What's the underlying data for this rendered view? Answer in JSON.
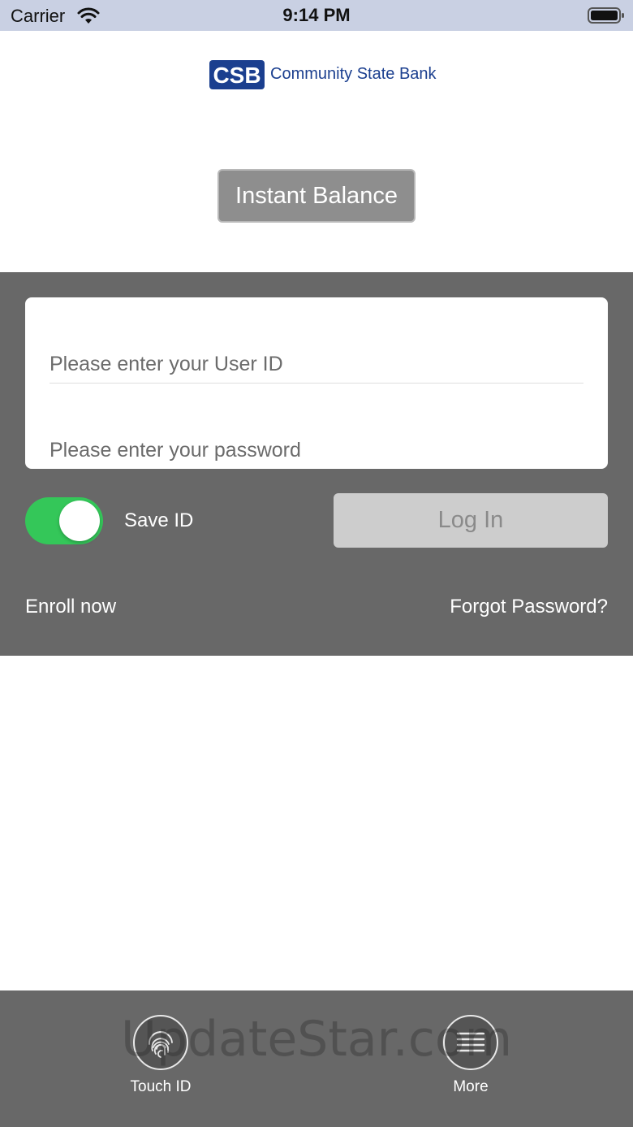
{
  "status_bar": {
    "carrier": "Carrier",
    "time": "9:14 PM"
  },
  "logo": {
    "mark": "CSB",
    "name": "Community State Bank"
  },
  "instant_balance": {
    "label": "Instant Balance"
  },
  "login": {
    "userid_placeholder": "Please enter your User ID",
    "password_placeholder": "Please enter your password",
    "save_id_label": "Save ID",
    "save_id_on": true,
    "login_label": "Log In",
    "enroll_label": "Enroll now",
    "forgot_label": "Forgot Password?"
  },
  "bottom_bar": {
    "touchid_label": "Touch ID",
    "more_label": "More"
  },
  "watermark": "UpdateStar.com",
  "colors": {
    "panel": "#686868",
    "toggle_on": "#34c759",
    "brand": "#1b3f8f"
  }
}
